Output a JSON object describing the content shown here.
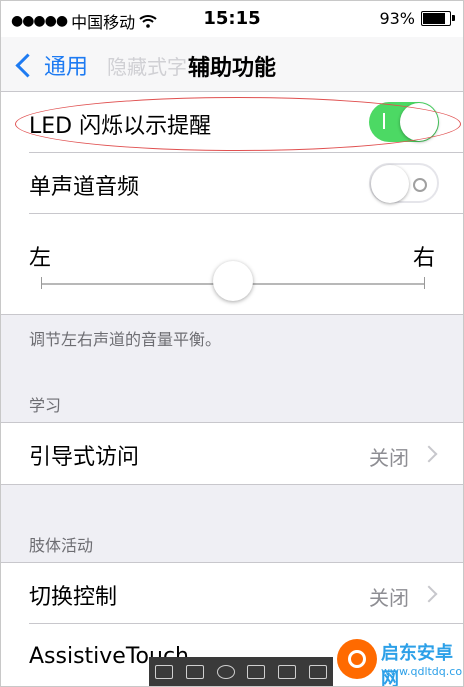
{
  "status_bar": {
    "signal_dots": "●●●●●",
    "carrier": "中国移动",
    "time": "15:15",
    "battery_text": "93%",
    "battery_level": 0.93
  },
  "nav": {
    "back_label": "通用",
    "ghost_title": "隐藏式字",
    "title": "辅助功能"
  },
  "rows": {
    "led": {
      "label": "LED 闪烁以示提醒",
      "toggle_on": true
    },
    "mono": {
      "label": "单声道音频",
      "toggle_on": false
    }
  },
  "balance": {
    "left_label": "左",
    "right_label": "右",
    "value": 0.5,
    "note": "调节左右声道的音量平衡。"
  },
  "sections": {
    "learning": {
      "header": "学习",
      "guided_access": {
        "label": "引导式访问",
        "detail": "关闭"
      }
    },
    "physical": {
      "header": "肢体活动",
      "switch_control": {
        "label": "切换控制",
        "detail": "关闭"
      },
      "assistive": {
        "label": "AssistiveTouch"
      }
    }
  },
  "watermark": {
    "title": "启东安卓网",
    "url": "www.qdltdq.com"
  },
  "colors": {
    "accent": "#1e7bf2",
    "toggle_on": "#4cd964",
    "highlight": "#e05050"
  }
}
